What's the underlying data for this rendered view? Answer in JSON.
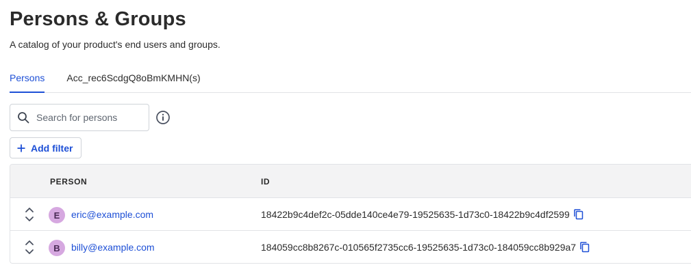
{
  "header": {
    "title": "Persons & Groups",
    "subtitle": "A catalog of your product's end users and groups."
  },
  "tabs": [
    {
      "label": "Persons",
      "active": true
    },
    {
      "label": "Acc_rec6ScdgQ8oBmKMHN(s)",
      "active": false
    }
  ],
  "search": {
    "placeholder": "Search for persons",
    "value": ""
  },
  "filters": {
    "add_label": "Add filter"
  },
  "table": {
    "columns": [
      "PERSON",
      "ID"
    ],
    "rows": [
      {
        "initial": "E",
        "email": "eric@example.com",
        "id": "18422b9c4def2c-05dde140ce4e79-19525635-1d73c0-18422b9c4df2599"
      },
      {
        "initial": "B",
        "email": "billy@example.com",
        "id": "184059cc8b8267c-010565f2735cc6-19525635-1d73c0-184059cc8b929a7"
      }
    ]
  },
  "colors": {
    "accent": "#1d4fd6",
    "avatar": "#d6a8e0",
    "header_bg": "#f3f3f4",
    "border": "#e1e3e6"
  },
  "icons": {
    "search": "search-icon",
    "info": "info-icon",
    "add": "plus-icon",
    "expand": "chevron-up-down-icon",
    "copy": "copy-icon"
  }
}
